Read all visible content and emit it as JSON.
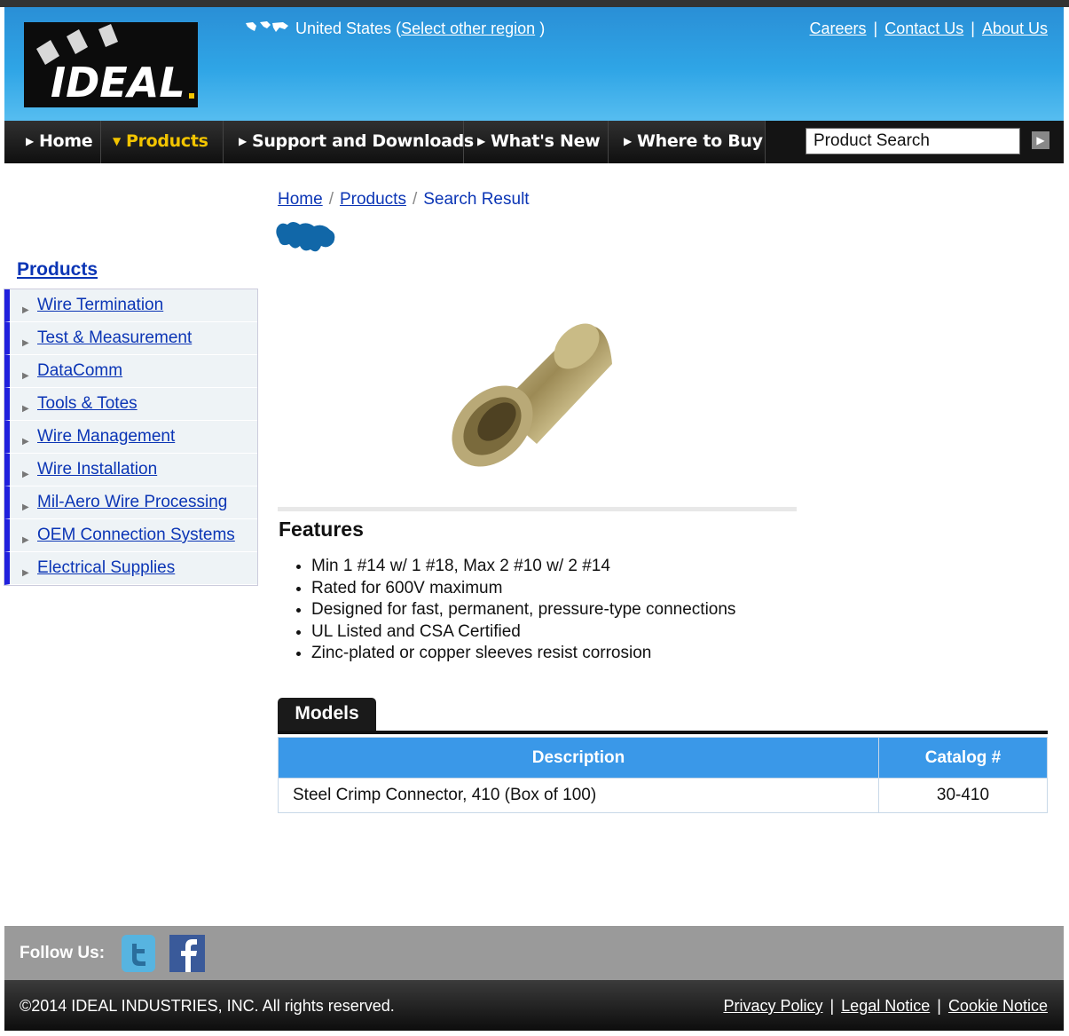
{
  "header": {
    "region_name": "United States",
    "region_open": "(",
    "region_link": "Select other region",
    "region_close": ")",
    "top_links": [
      "Careers",
      "Contact Us",
      "About Us"
    ],
    "logo_text": "IDEAL"
  },
  "nav": {
    "items": [
      "Home",
      "Products",
      "Support and Downloads",
      "What's New",
      "Where to Buy"
    ],
    "active": "Products",
    "search_placeholder": "Product Search"
  },
  "breadcrumb": {
    "home": "Home",
    "products": "Products",
    "current": "Search Result"
  },
  "sidebar": {
    "title": "Products",
    "items": [
      "Wire Termination",
      "Test & Measurement",
      "DataComm",
      "Tools & Totes",
      "Wire Management",
      "Wire Installation",
      "Mil-Aero Wire Processing",
      "OEM Connection Systems",
      "Electrical Supplies"
    ]
  },
  "features": {
    "heading": "Features",
    "items": [
      "Min 1 #14 w/ 1 #18, Max 2 #10 w/ 2 #14",
      "Rated for 600V maximum",
      "Designed for fast, permanent, pressure-type connections",
      "UL Listed and CSA Certified",
      "Zinc-plated or copper sleeves resist corrosion"
    ]
  },
  "models": {
    "tab_label": "Models",
    "columns": [
      "Description",
      "Catalog #"
    ],
    "rows": [
      [
        "Steel Crimp Connector, 410 (Box of 100)",
        "30-410"
      ]
    ]
  },
  "footer": {
    "follow_label": "Follow Us:",
    "copyright": "©2014 IDEAL INDUSTRIES, INC. All rights reserved.",
    "legal_links": [
      "Privacy Policy",
      "Legal Notice",
      "Cookie Notice"
    ]
  },
  "colors": {
    "header_blue": "#2fa5e6",
    "nav_active": "#f2c400",
    "table_header": "#3a98e8",
    "sidebar_bar": "#2020dd",
    "link": "#0b35b5"
  }
}
